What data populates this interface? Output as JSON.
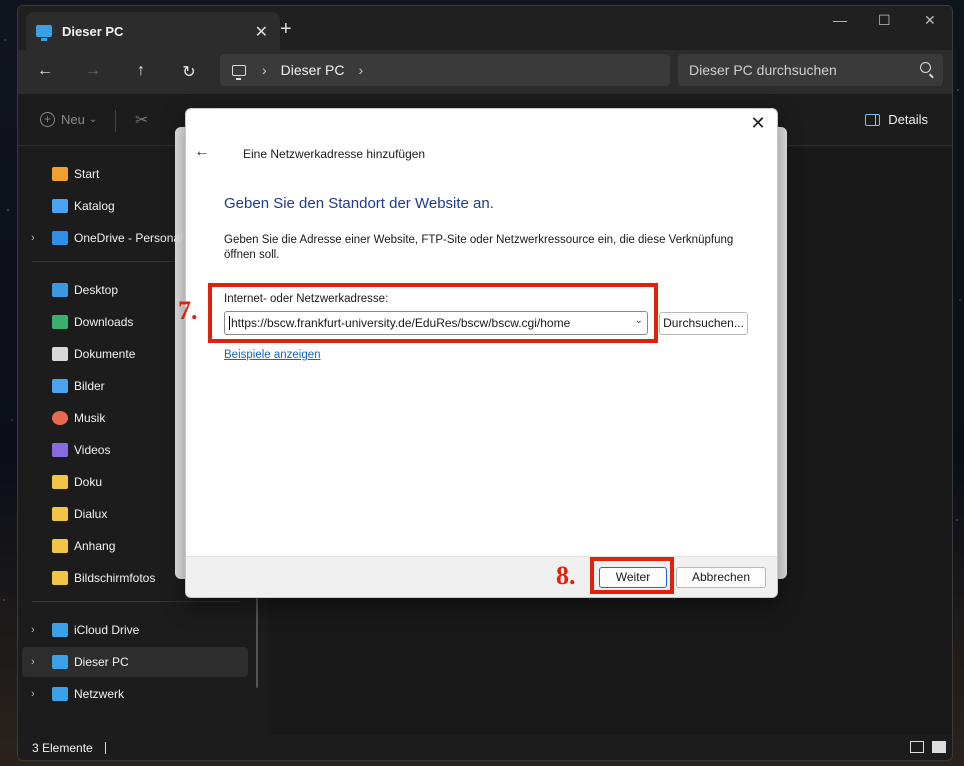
{
  "window": {
    "tab_title": "Dieser PC",
    "tab_close": "✕",
    "new_tab": "+",
    "minimize": "—",
    "maximize": "☐",
    "close": "✕"
  },
  "nav": {
    "back": "←",
    "forward": "→",
    "up": "↑",
    "refresh": "↻",
    "breadcrumb": [
      "Dieser PC"
    ],
    "search_placeholder": "Dieser PC durchsuchen"
  },
  "command_bar": {
    "new_label": "Neu",
    "new_chevron": "⌄",
    "cut_icon": "✂",
    "details_label": "Details"
  },
  "sidebar": {
    "groups": [
      [
        {
          "label": "Start",
          "icon": "home-icon",
          "expand": false
        },
        {
          "label": "Katalog",
          "icon": "gallery-icon",
          "expand": false
        },
        {
          "label": "OneDrive - Personal",
          "icon": "onedrive-icon",
          "expand": true
        }
      ],
      [
        {
          "label": "Desktop",
          "icon": "desktop-icon",
          "expand": false
        },
        {
          "label": "Downloads",
          "icon": "downloads-icon",
          "expand": false
        },
        {
          "label": "Dokumente",
          "icon": "documents-icon",
          "expand": false
        },
        {
          "label": "Bilder",
          "icon": "pictures-icon",
          "expand": false
        },
        {
          "label": "Musik",
          "icon": "music-icon",
          "expand": false
        },
        {
          "label": "Videos",
          "icon": "videos-icon",
          "expand": false
        },
        {
          "label": "Doku",
          "icon": "folder-icon",
          "expand": false
        },
        {
          "label": "Dialux",
          "icon": "folder-icon",
          "expand": false
        },
        {
          "label": "Anhang",
          "icon": "folder-icon",
          "expand": false
        },
        {
          "label": "Bildschirmfotos",
          "icon": "folder-icon",
          "expand": false
        }
      ],
      [
        {
          "label": "iCloud Drive",
          "icon": "icloud-icon",
          "expand": true
        },
        {
          "label": "Dieser PC",
          "icon": "pc-icon",
          "expand": true,
          "selected": true
        },
        {
          "label": "Netzwerk",
          "icon": "network-icon",
          "expand": true
        }
      ]
    ]
  },
  "status": {
    "item_count": "3 Elemente"
  },
  "dialog": {
    "close": "✕",
    "back": "←",
    "title": "Eine Netzwerkadresse hinzufügen",
    "heading": "Geben Sie den Standort der Website an.",
    "description": "Geben Sie die Adresse einer Website, FTP-Site oder Netzwerkressource ein, die diese Verknüpfung öffnen soll.",
    "field_label": "Internet- oder Netzwerkadresse:",
    "url_value": "https://bscw.frankfurt-university.de/EduRes/bscw/bscw.cgi/home",
    "browse_label": "Durchsuchen...",
    "examples_link": "Beispiele anzeigen",
    "next_label": "Weiter",
    "cancel_label": "Abbrechen"
  },
  "annotations": {
    "step7": "7.",
    "step8": "8.",
    "color": "#e0220c"
  },
  "colors": {
    "accent": "#1a6fd0",
    "heading": "#1e3c8c",
    "link": "#1565c0",
    "folder": "#f3c547"
  }
}
